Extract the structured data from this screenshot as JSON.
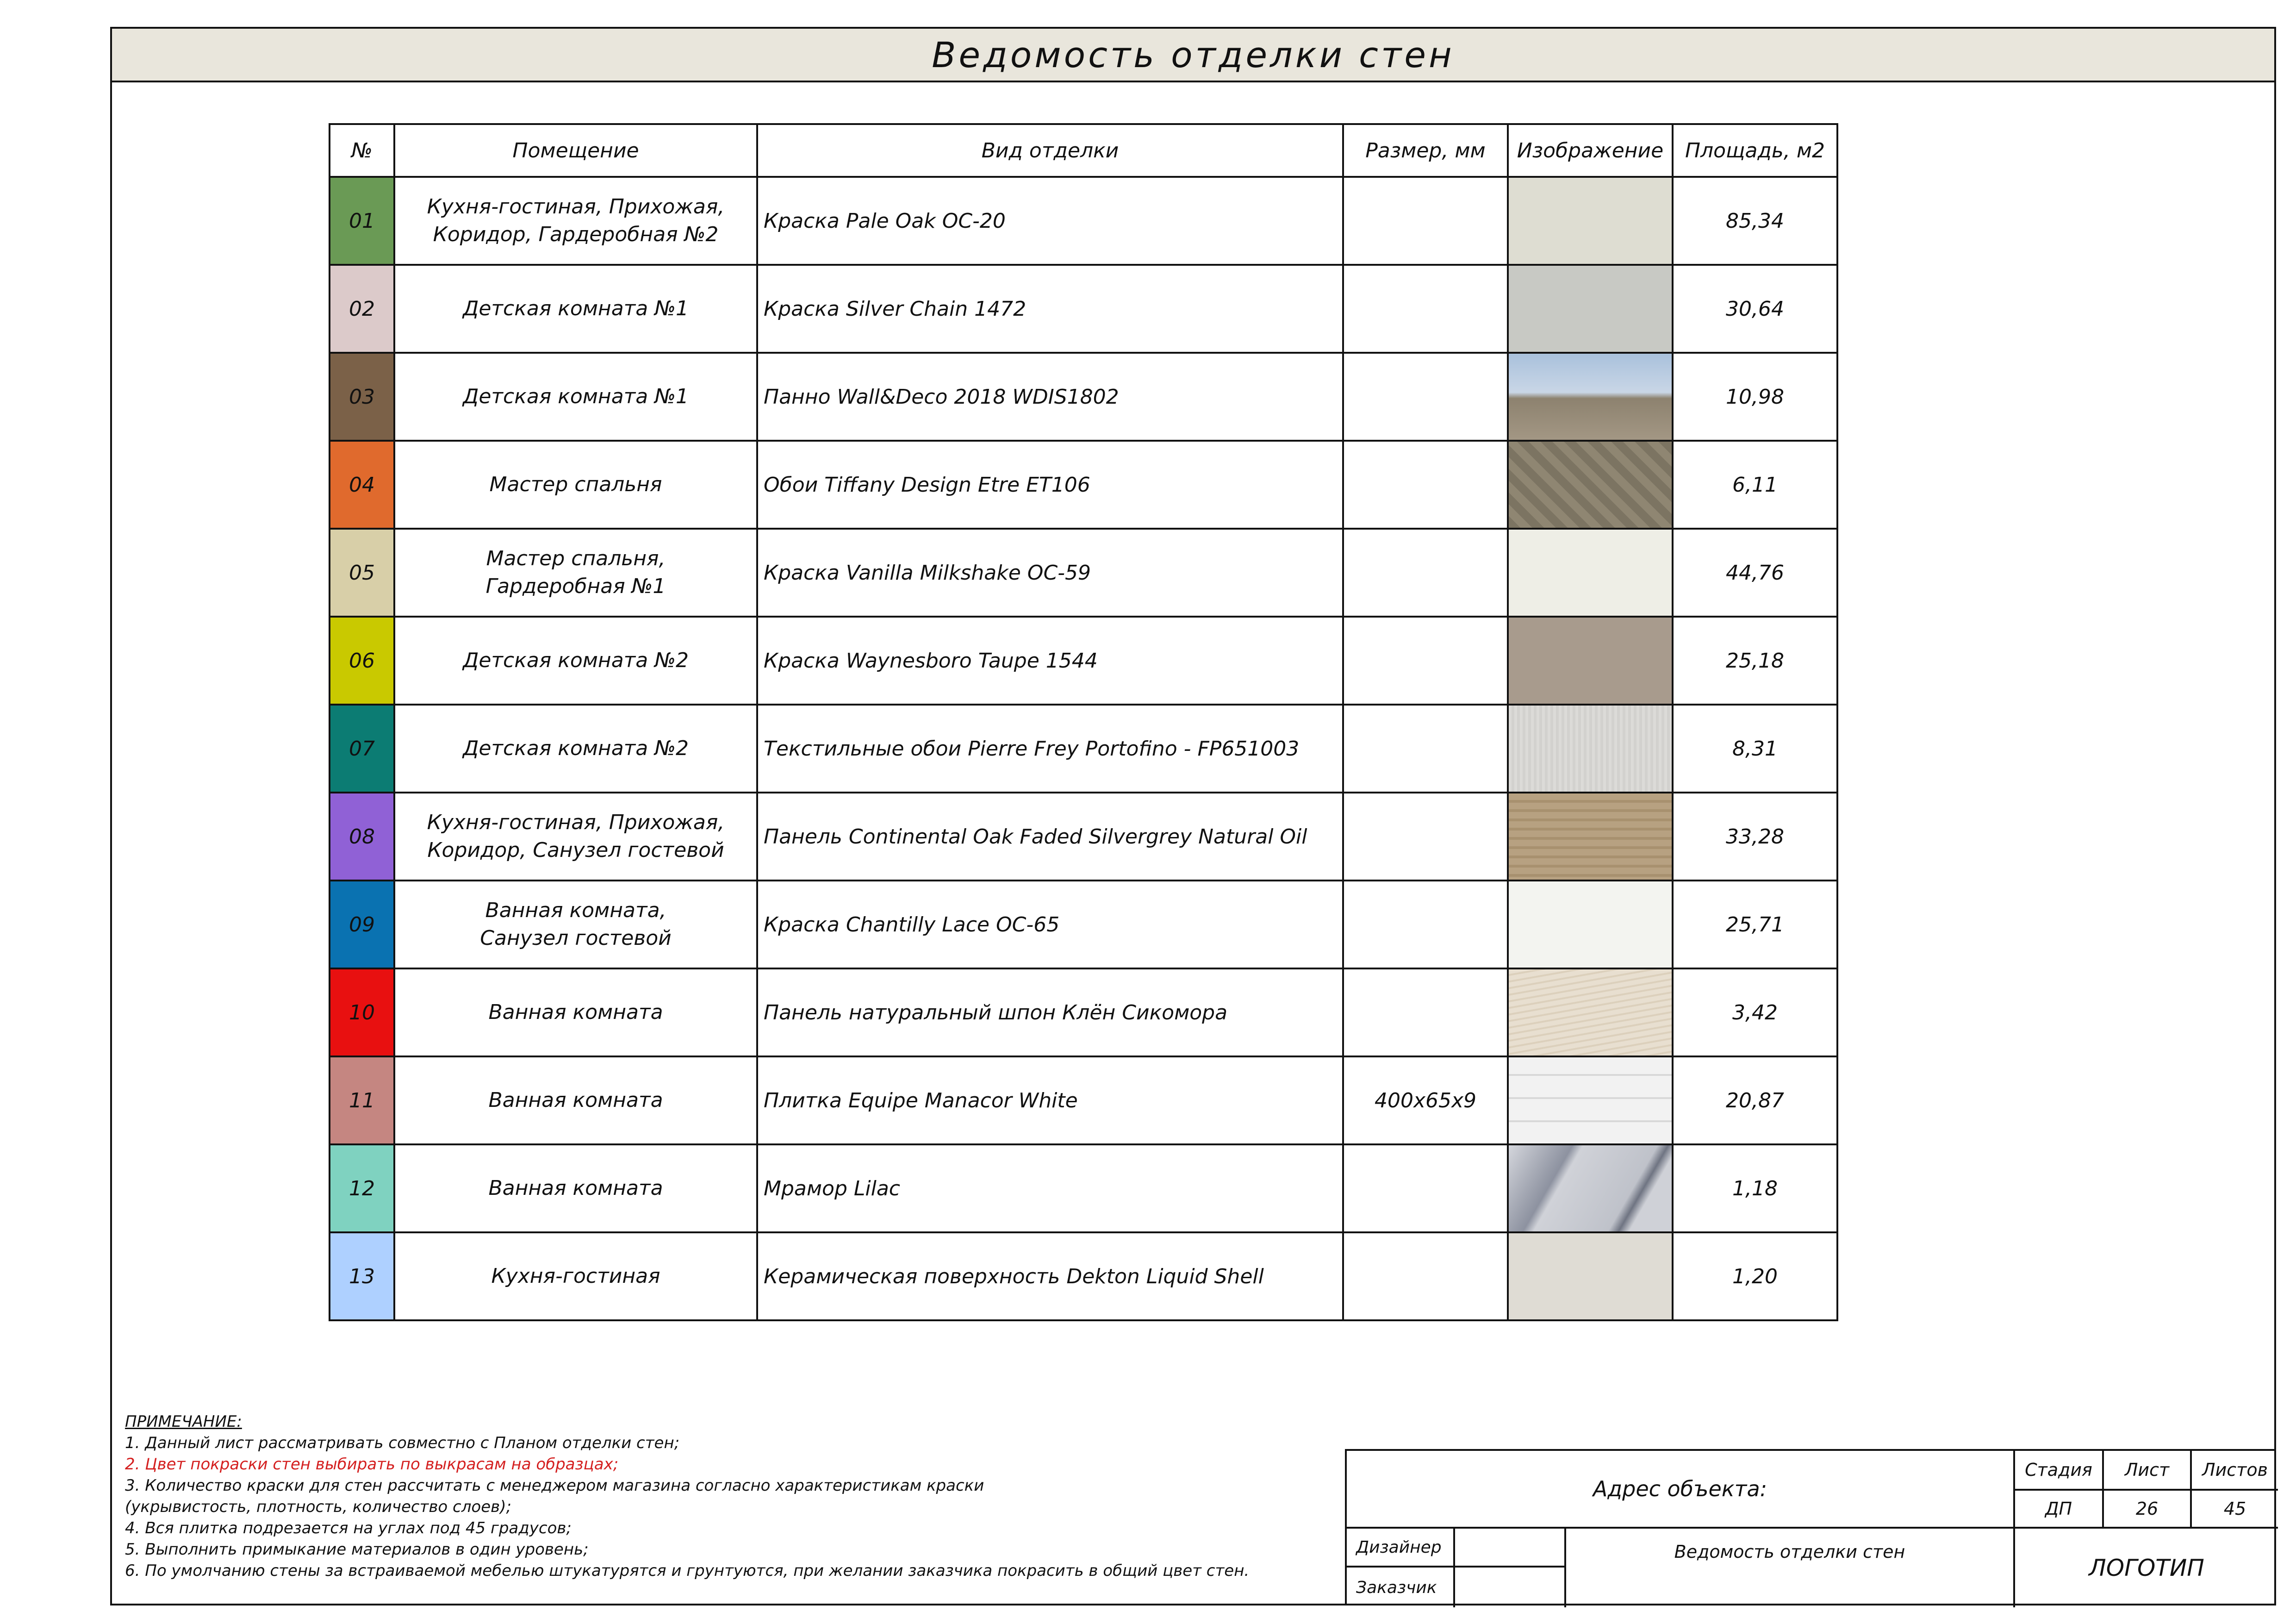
{
  "title": "Ведомость отделки стен",
  "table": {
    "headers": [
      "№",
      "Помещение",
      "Вид отделки",
      "Размер, мм",
      "Изображение",
      "Площадь, м2"
    ],
    "rows": [
      {
        "no": "01",
        "room_l1": "Кухня-гостиная, Прихожая,",
        "room_l2": "Коридор, Гардеробная №2",
        "type": "Краска Pale Oak OC-20",
        "size": "",
        "area": "85,34",
        "color": "#6a9a55",
        "swatch": "#deddd2"
      },
      {
        "no": "02",
        "room_l1": "Детская комната №1",
        "room_l2": "",
        "type": "Краска Silver Chain 1472",
        "size": "",
        "area": "30,64",
        "color": "#dccaca",
        "swatch": "#c8c9c4"
      },
      {
        "no": "03",
        "room_l1": "Детская комната №1",
        "room_l2": "",
        "type": "Панно Wall&Deco 2018 WDIS1802",
        "size": "",
        "area": "10,98",
        "color": "#7b6148",
        "swatch": "#9fb1c9"
      },
      {
        "no": "04",
        "room_l1": "Мастер спальня",
        "room_l2": "",
        "type": "Обои Tiffany Design Etre ET106",
        "size": "",
        "area": "6,11",
        "color": "#e06a2d",
        "swatch": "#7c7462"
      },
      {
        "no": "05",
        "room_l1": "Мастер спальня,",
        "room_l2": "Гардеробная №1",
        "type": "Краска Vanilla Milkshake OC-59",
        "size": "",
        "area": "44,76",
        "color": "#d8cfa8",
        "swatch": "#eeeee6"
      },
      {
        "no": "06",
        "room_l1": "Детская комната №2",
        "room_l2": "",
        "type": "Краска Waynesboro Taupe 1544",
        "size": "",
        "area": "25,18",
        "color": "#c9c900",
        "swatch": "#a89b8d"
      },
      {
        "no": "07",
        "room_l1": "Детская комната №2",
        "room_l2": "",
        "type": "Текстильные обои Pierre Frey Portofino - FP651003",
        "size": "",
        "area": "8,31",
        "color": "#0c7c73",
        "swatch": "#dcdbd8"
      },
      {
        "no": "08",
        "room_l1": "Кухня-гостиная, Прихожая,",
        "room_l2": "Коридор, Санузел гостевой",
        "type": "Панель Continental Oak Faded Silvergrey Natural Oil",
        "size": "",
        "area": "33,28",
        "color": "#9061d6",
        "swatch": "#b7a181"
      },
      {
        "no": "09",
        "room_l1": "Ванная комната,",
        "room_l2": "Санузел гостевой",
        "type": "Краска Chantilly Lace OC-65",
        "size": "",
        "area": "25,71",
        "color": "#0a72b1",
        "swatch": "#f3f4f0"
      },
      {
        "no": "10",
        "room_l1": "Ванная комната",
        "room_l2": "",
        "type": "Панель натуральный шпон Клён Сикомора",
        "size": "",
        "area": "3,42",
        "color": "#e81010",
        "swatch": "#e5dccc"
      },
      {
        "no": "11",
        "room_l1": "Ванная комната",
        "room_l2": "",
        "type": "Плитка Equipe Manacor White",
        "size": "400x65x9",
        "area": "20,87",
        "color": "#c58681",
        "swatch": "#ececec"
      },
      {
        "no": "12",
        "room_l1": "Ванная комната",
        "room_l2": "",
        "type": "Мрамор Lilac",
        "size": "",
        "area": "1,18",
        "color": "#7fd2c0",
        "swatch": "#c7c9d0"
      },
      {
        "no": "13",
        "room_l1": "Кухня-гостиная",
        "room_l2": "",
        "type": "Керамическая поверхность Dekton Liquid Shell",
        "size": "",
        "area": "1,20",
        "color": "#aed0ff",
        "swatch": "#dfdcd4"
      }
    ]
  },
  "notes": {
    "title": "ПРИМЕЧАНИЕ:",
    "lines": [
      "1. Данный лист рассматривать совместно с Планом отделки стен;",
      "2. Цвет покраски стен выбирать по выкрасам на образцах;",
      "3. Количество краски для стен рассчитать с менеджером магазина согласно характеристикам краски",
      "(укрывистость, плотность, количество слоев);",
      "4. Вся плитка подрезается на углах под 45 градусов;",
      "5. Выполнить примыкание материалов в один уровень;",
      "6. По умолчанию стены за встраиваемой мебелью штукатурятся и грунтуются, при желании заказчика покрасить в общий цвет стен."
    ],
    "highlight_color": "#d41f1f"
  },
  "stamp": {
    "address": "Адрес объекта:",
    "stage_label": "Стадия",
    "sheet_label": "Лист",
    "sheets_label": "Листов",
    "stage": "ДП",
    "sheet": "26",
    "sheets": "45",
    "designer": "Дизайнер",
    "customer": "Заказчик",
    "doc_title": "Ведомость отделки стен",
    "logo": "ЛОГОТИП"
  },
  "colors": {
    "header_bg": "#e9e6dc",
    "border": "#111111"
  }
}
